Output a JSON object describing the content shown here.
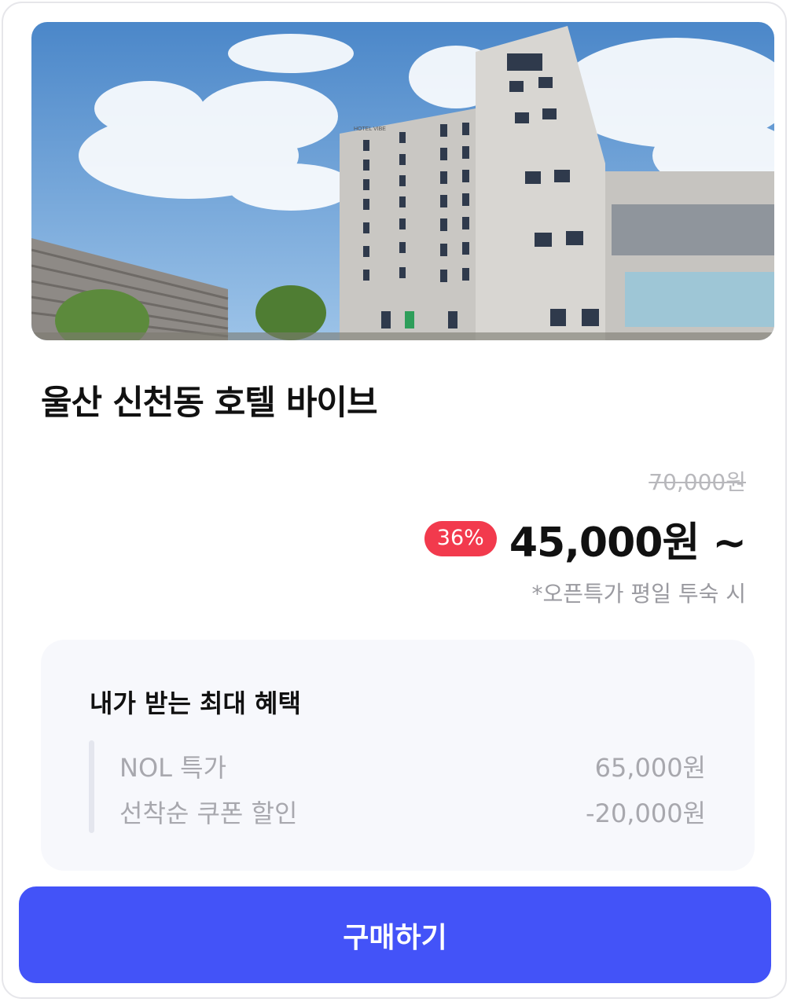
{
  "hotel": {
    "image_alt": "호텔 바이브 외관",
    "sign_text": "HOTEL VIBE",
    "title": "울산 신천동 호텔 바이브"
  },
  "pricing": {
    "original_price": "70,000원",
    "discount_badge": "36%",
    "sale_price": "45,000원 ~",
    "note": "*오픈특가 평일 투숙 시"
  },
  "benefit": {
    "title": "내가 받는 최대 혜택",
    "rows": [
      {
        "label": "NOL 특가",
        "value": "65,000원"
      },
      {
        "label": "선착순 쿠폰 할인",
        "value": "-20,000원"
      }
    ]
  },
  "cta": {
    "label": "구매하기"
  },
  "colors": {
    "accent": "#4353f8",
    "badge": "#f23a4d"
  }
}
